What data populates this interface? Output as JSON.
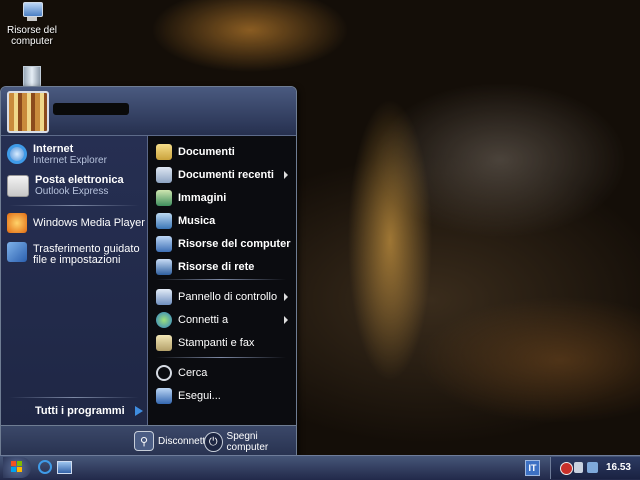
{
  "desktop": {
    "icons": [
      {
        "label": "Risorse del computer",
        "icon": "my-computer-icon"
      },
      {
        "label": "",
        "icon": "recycle-bin-icon"
      }
    ]
  },
  "start_menu": {
    "user_name": "",
    "pinned": [
      {
        "title": "Internet",
        "subtitle": "Internet Explorer",
        "icon": "internet-explorer-icon"
      },
      {
        "title": "Posta elettronica",
        "subtitle": "Outlook Express",
        "icon": "outlook-express-icon"
      }
    ],
    "recent": [
      {
        "label": "Windows Media Player",
        "icon": "media-player-icon"
      },
      {
        "label": "Trasferimento guidato file e impostazioni",
        "icon": "transfer-wizard-icon"
      }
    ],
    "all_programs": "Tutti i programmi",
    "places": [
      {
        "label": "Documenti",
        "icon": "documents-folder-icon",
        "arrow": false
      },
      {
        "label": "Documenti recenti",
        "icon": "recent-documents-icon",
        "arrow": true
      },
      {
        "label": "Immagini",
        "icon": "pictures-folder-icon",
        "arrow": false
      },
      {
        "label": "Musica",
        "icon": "music-folder-icon",
        "arrow": false
      },
      {
        "label": "Risorse del computer",
        "icon": "my-computer-icon",
        "arrow": false
      },
      {
        "label": "Risorse di rete",
        "icon": "network-places-icon",
        "arrow": false
      }
    ],
    "system": [
      {
        "label": "Pannello di controllo",
        "icon": "control-panel-icon",
        "arrow": true
      },
      {
        "label": "Connetti a",
        "icon": "connect-to-icon",
        "arrow": true
      },
      {
        "label": "Stampanti e fax",
        "icon": "printers-icon",
        "arrow": false
      }
    ],
    "tools": [
      {
        "label": "Cerca",
        "icon": "search-icon",
        "arrow": false
      },
      {
        "label": "Esegui...",
        "icon": "run-icon",
        "arrow": false
      }
    ],
    "footer": {
      "logoff": "Disconnetti",
      "shutdown": "Spegni computer"
    }
  },
  "taskbar": {
    "language": "IT",
    "clock": "16.53"
  },
  "colors": {
    "menu_left": "#262f52",
    "menu_right": "#0b0c10",
    "taskbar": "#2f3a5e",
    "accent_blue": "#3f8de0"
  }
}
